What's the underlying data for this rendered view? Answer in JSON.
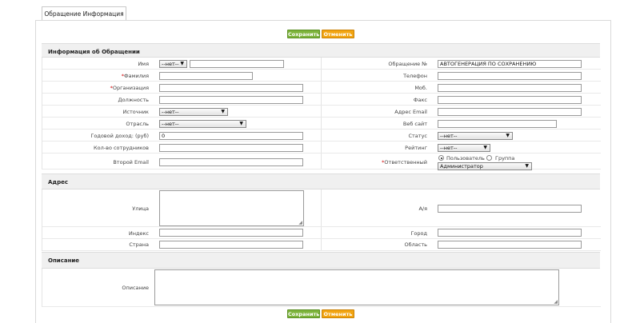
{
  "tab": {
    "label": "Обращение Информация"
  },
  "buttons": {
    "save": "Сохранить",
    "cancel": "Отменить"
  },
  "sections": {
    "info": "Информация об Обращении",
    "address": "Адрес",
    "description": "Описание"
  },
  "left_fields": {
    "first_name": {
      "label": "Имя",
      "salutation": "--нет--",
      "value": ""
    },
    "last_name": {
      "label": "*Фамилия",
      "value": ""
    },
    "organization": {
      "label": "*Организация",
      "value": ""
    },
    "position": {
      "label": "Должность",
      "value": ""
    },
    "source": {
      "label": "Источник",
      "value": "--нет--"
    },
    "industry": {
      "label": "Отрасль",
      "value": "--нет--"
    },
    "annual_income": {
      "label": "Годовой доход: (руб)",
      "value": "0"
    },
    "employees": {
      "label": "Кол-во сотрудников",
      "value": ""
    },
    "second_email": {
      "label": "Второй Email",
      "value": ""
    }
  },
  "right_fields": {
    "lead_no": {
      "label": "Обращение №",
      "value": "АВТОГЕНЕРАЦИЯ ПО СОХРАНЕНИЮ"
    },
    "phone": {
      "label": "Телефон",
      "value": ""
    },
    "mobile": {
      "label": "Моб.",
      "value": ""
    },
    "fax": {
      "label": "Факс",
      "value": ""
    },
    "email": {
      "label": "Адрес Email",
      "value": ""
    },
    "website": {
      "label": "Веб сайт",
      "value": ""
    },
    "status": {
      "label": "Статус",
      "value": "--нет--"
    },
    "rating": {
      "label": "Рейтинг",
      "value": "--нет--"
    },
    "assigned": {
      "label": "*Ответственный",
      "opt_user": "Пользователь",
      "opt_group": "Группа",
      "value": "Администратор"
    }
  },
  "address": {
    "street": {
      "label": "Улица",
      "value": ""
    },
    "po_box": {
      "label": "А/я",
      "value": ""
    },
    "zip": {
      "label": "Индекс",
      "value": ""
    },
    "city": {
      "label": "Город",
      "value": ""
    },
    "country": {
      "label": "Страна",
      "value": ""
    },
    "state": {
      "label": "Область",
      "value": ""
    }
  },
  "description": {
    "label": "Описание",
    "value": ""
  }
}
